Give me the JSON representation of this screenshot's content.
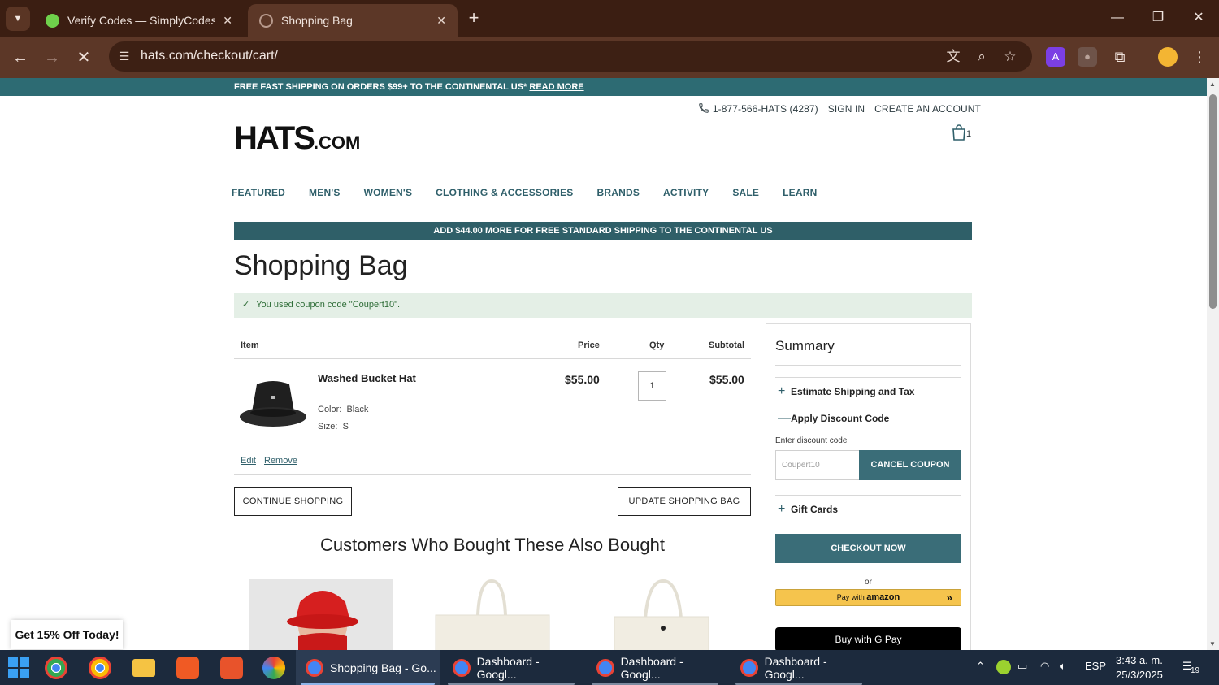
{
  "browser": {
    "tabs": [
      {
        "title": "Verify Codes — SimplyCodes",
        "active": false
      },
      {
        "title": "Shopping Bag",
        "active": true
      }
    ],
    "url": "hats.com/checkout/cart/"
  },
  "promo_bar": {
    "text": "FREE FAST SHIPPING ON ORDERS $99+ TO THE CONTINENTAL US*",
    "link": "READ MORE"
  },
  "utility": {
    "phone": "1-877-566-HATS (4287)",
    "sign_in": "SIGN IN",
    "create_account": "CREATE AN ACCOUNT"
  },
  "logo": {
    "main": "HATS",
    "suffix": ".COM"
  },
  "cart_count": "1",
  "nav": [
    "FEATURED",
    "MEN'S",
    "WOMEN'S",
    "CLOTHING & ACCESSORIES",
    "BRANDS",
    "ACTIVITY",
    "SALE",
    "LEARN"
  ],
  "shipping_banner": "ADD $44.00 MORE FOR FREE STANDARD SHIPPING TO THE CONTINENTAL US",
  "page_title": "Shopping Bag",
  "coupon_message": "You used coupon code \"Coupert10\".",
  "cart": {
    "headers": {
      "item": "Item",
      "price": "Price",
      "qty": "Qty",
      "subtotal": "Subtotal"
    },
    "item": {
      "name": "Washed Bucket Hat",
      "color_label": "Color:",
      "color": "Black",
      "size_label": "Size:",
      "size": "S",
      "price": "$55.00",
      "qty": "1",
      "subtotal": "$55.00",
      "edit": "Edit",
      "remove": "Remove"
    },
    "continue_btn": "CONTINUE SHOPPING",
    "update_btn": "UPDATE SHOPPING BAG"
  },
  "also_bought_title": "Customers Who Bought These Also Bought",
  "summary": {
    "title": "Summary",
    "estimate": "Estimate Shipping and Tax",
    "discount": "Apply Discount Code",
    "discount_label": "Enter discount code",
    "discount_value": "Coupert10",
    "cancel_btn": "CANCEL COUPON",
    "gift": "Gift Cards",
    "checkout_btn": "CHECKOUT NOW",
    "or": "or",
    "amazon_prefix": "Pay with",
    "amazon_brand": "amazon",
    "gpay_prefix": "Buy with",
    "gpay_brand": "G Pay"
  },
  "popup": "Get 15% Off Today!",
  "taskbar": {
    "windows": [
      {
        "title": "Shopping Bag - Go...",
        "active": true
      },
      {
        "title": "Dashboard - Googl...",
        "active": false
      },
      {
        "title": "Dashboard - Googl...",
        "active": false
      },
      {
        "title": "Dashboard - Googl...",
        "active": false
      }
    ],
    "lang": "ESP",
    "time": "3:43 a. m.",
    "date": "25/3/2025",
    "notif_count": "19"
  },
  "colors": {
    "teal": "#2f5f68",
    "chrome": "#5c3727",
    "tabstrip": "#3b1e12",
    "taskbar": "#1c2a3d"
  }
}
